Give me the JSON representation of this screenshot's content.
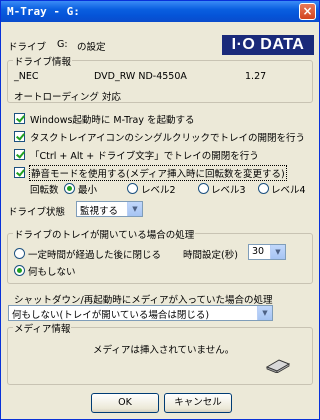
{
  "window": {
    "title": "M-Tray - G:",
    "close_glyph": "×"
  },
  "header": {
    "drive_label": "ドライブ",
    "drive_letter": "G:",
    "settings_label": "の設定",
    "logo_text": "I·O DATA"
  },
  "drive_info": {
    "group_label": "ドライブ情報",
    "vendor": "_NEC",
    "model": "DVD_RW ND-4550A",
    "firmware": "1.27",
    "autoloading_label": "オートローディング 対応"
  },
  "options": [
    {
      "label": "Windows起動時に M-Tray を起動する",
      "checked": true
    },
    {
      "label": "タスクトレイアイコンのシングルクリックでトレイの開閉を行う",
      "checked": true
    },
    {
      "label": "「Ctrl + Alt + ドライブ文字」でトレイの開閉を行う",
      "checked": true
    },
    {
      "label": "静音モードを使用する(メディア挿入時に回転数を変更する)",
      "checked": true
    }
  ],
  "rotation": {
    "label": "回転数",
    "choices": [
      "最小",
      "レベル2",
      "レベル3",
      "レベル4"
    ],
    "selected": "最小"
  },
  "drive_state": {
    "label": "ドライブ状態",
    "value": "監視する"
  },
  "tray_open": {
    "group_label": "ドライブのトレイが開いている場合の処理",
    "option_close": "一定時間が経過した後に閉じる",
    "time_label": "時間設定(秒)",
    "time_value": "30",
    "option_nothing": "何もしない",
    "selected": "何もしない"
  },
  "shutdown": {
    "label": "シャットダウン/再起動時にメディアが入っていた場合の処理",
    "value": "何もしない(トレイが開いている場合は閉じる)"
  },
  "media_info": {
    "group_label": "メディア情報",
    "message": "メディアは挿入されていません。",
    "icon": "drive-tray-icon"
  },
  "buttons": {
    "ok": "OK",
    "cancel": "キャンセル"
  },
  "colors": {
    "title_bar": "#0a5fe0",
    "window_bg": "#ece9d8",
    "check_mark": "#21a121",
    "logo_bg": "#1a2a7a"
  }
}
